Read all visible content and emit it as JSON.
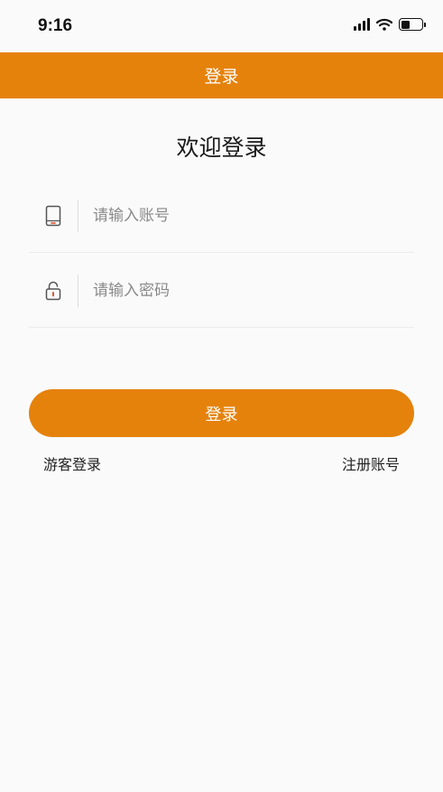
{
  "status_bar": {
    "time": "9:16",
    "battery_level": 0.45
  },
  "nav": {
    "title": "登录"
  },
  "welcome": "欢迎登录",
  "account": {
    "placeholder": "请输入账号",
    "value": "",
    "icon": "phone-icon"
  },
  "password": {
    "placeholder": "请输入密码",
    "value": "",
    "icon": "lock-icon"
  },
  "login_button": {
    "label": "登录"
  },
  "links": {
    "guest": "游客登录",
    "register": "注册账号"
  },
  "colors": {
    "accent": "#e5820c",
    "background": "#fafafa"
  }
}
